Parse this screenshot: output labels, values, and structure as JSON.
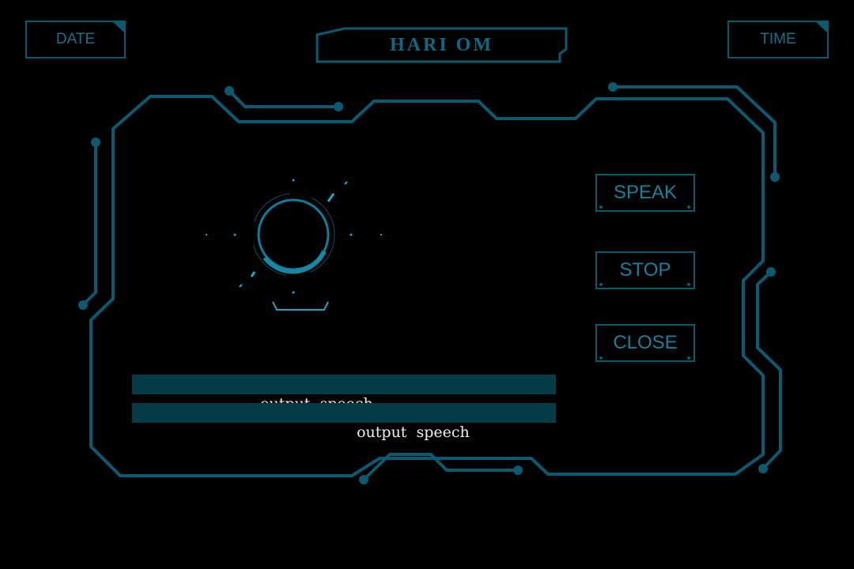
{
  "header": {
    "date_label": "DATE",
    "time_label": "TIME",
    "title": "HARI OM"
  },
  "controls": {
    "speak_label": "SPEAK",
    "stop_label": "STOP",
    "close_label": "CLOSE"
  },
  "output": {
    "line1": "output  speech",
    "line2": "output  speech"
  },
  "colors": {
    "frame": "#0b5a70",
    "bar": "#053a47",
    "accent": "#1fa6c7"
  }
}
